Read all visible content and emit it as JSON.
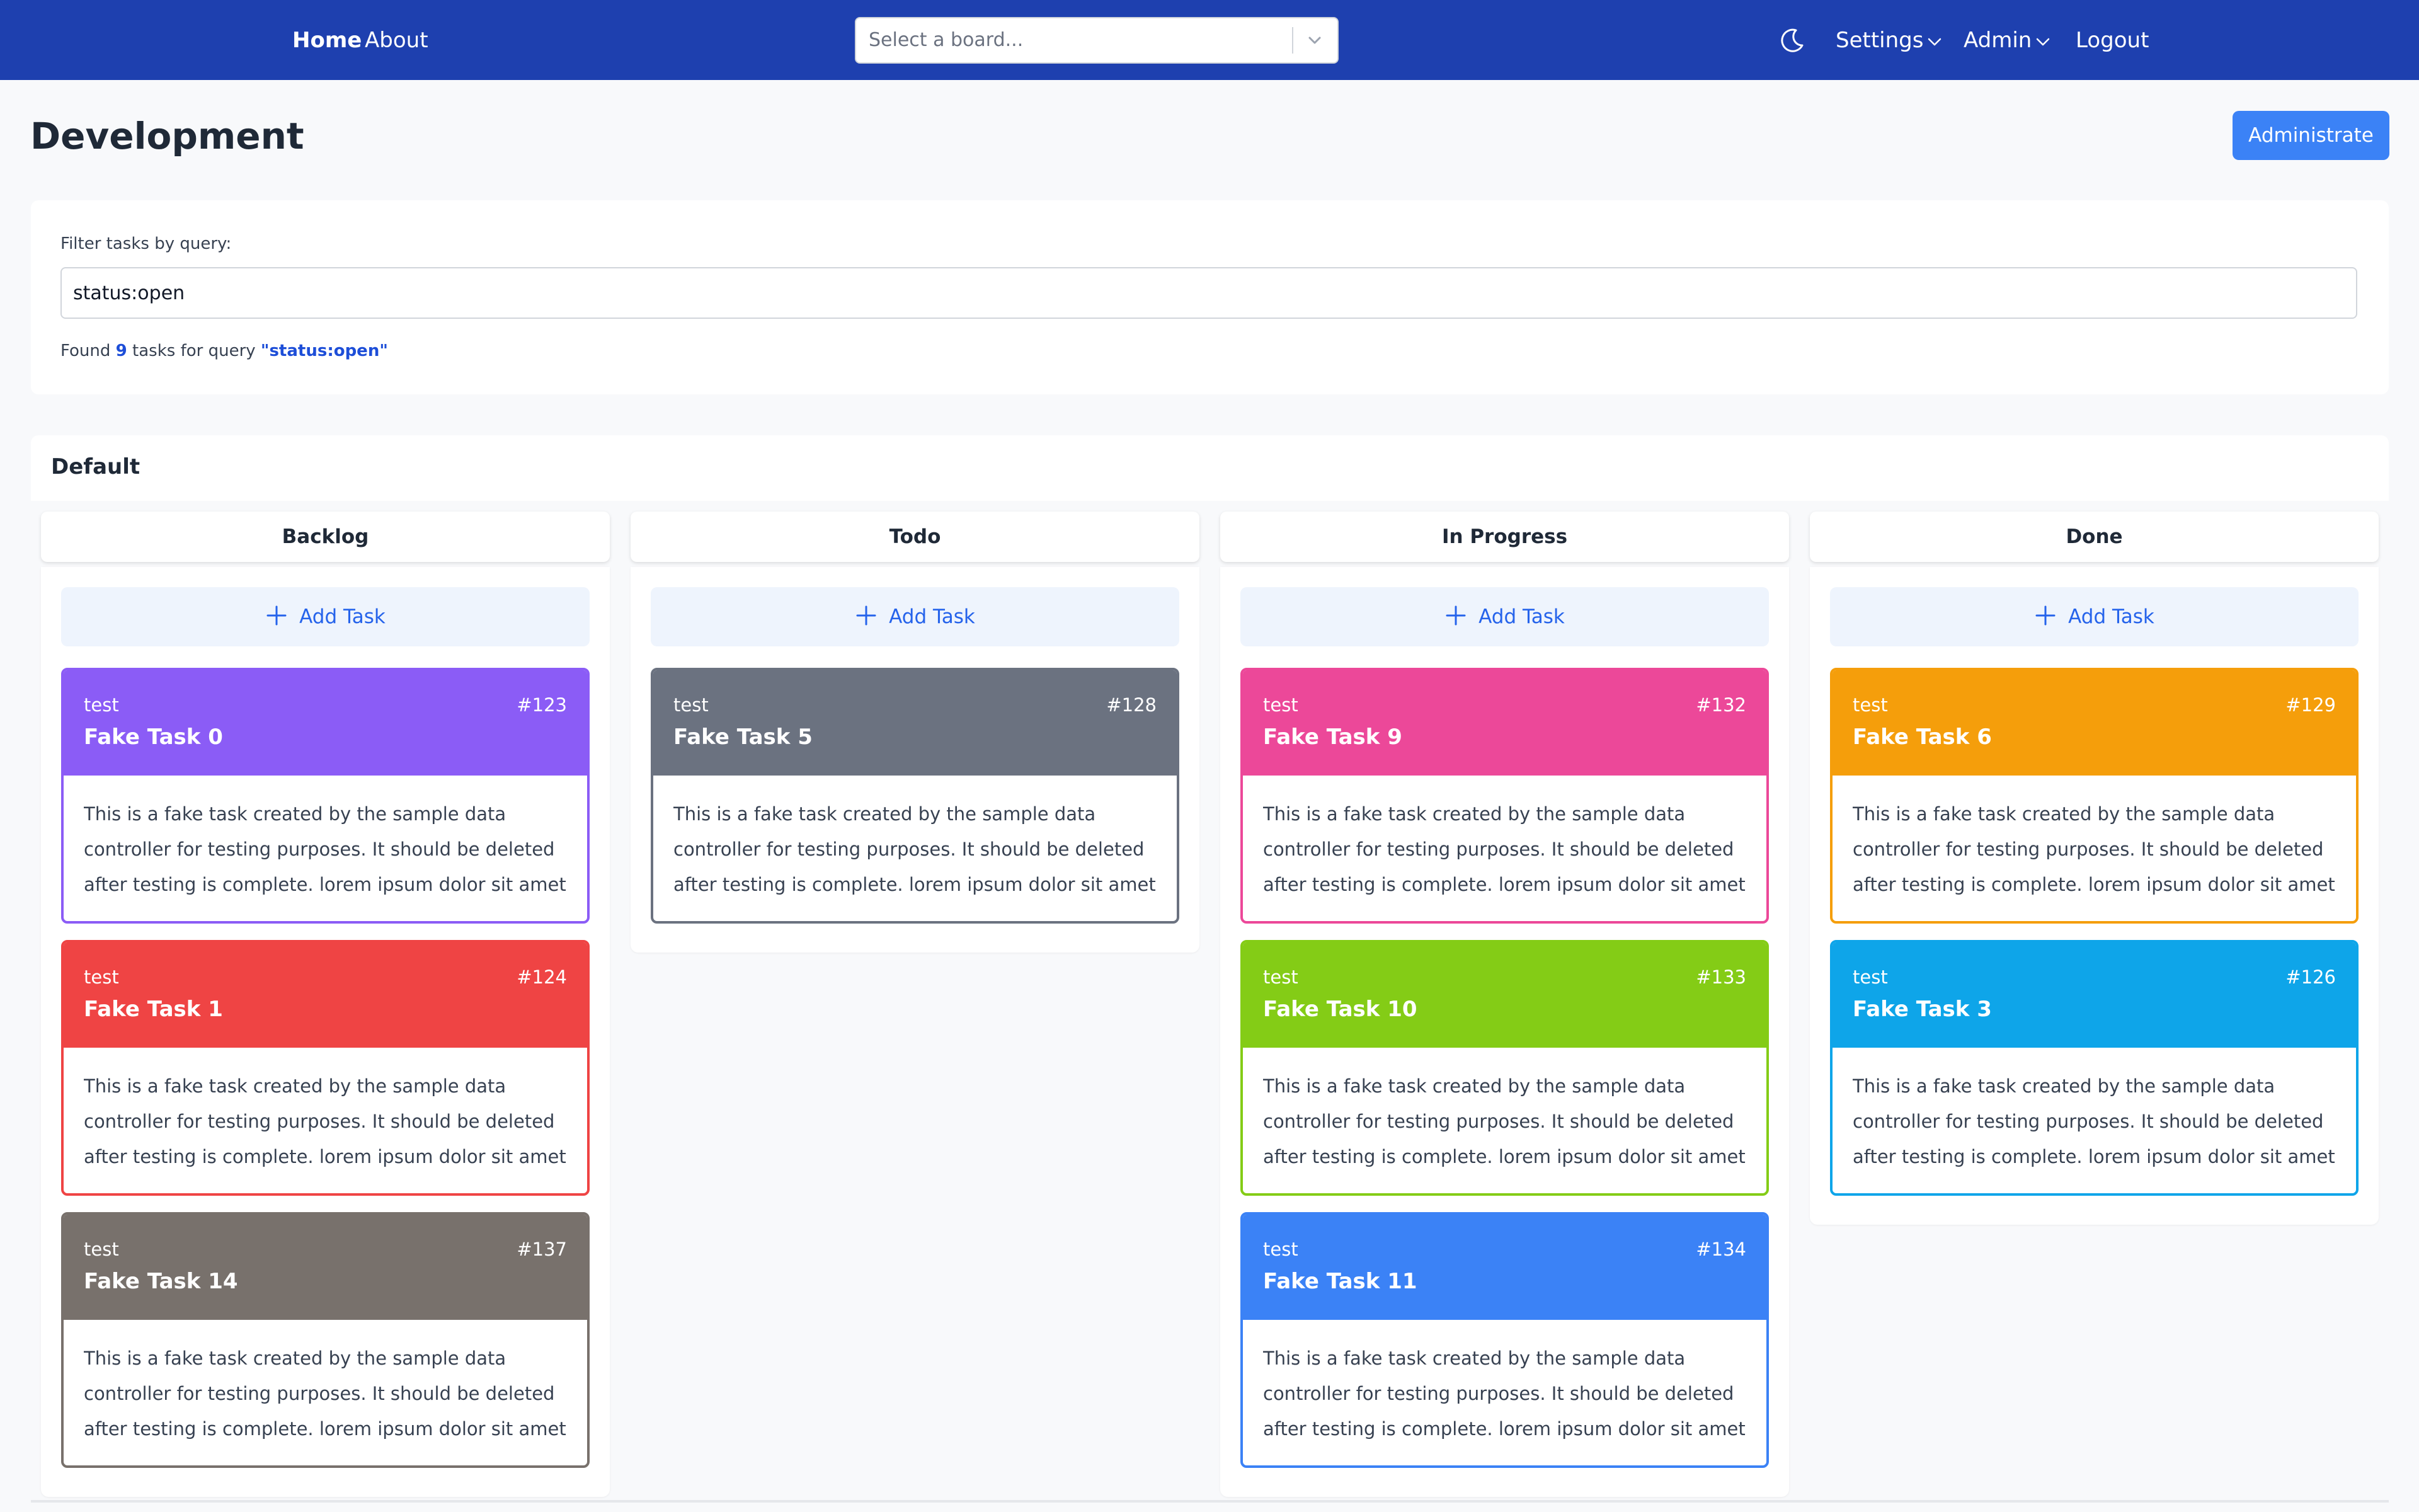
{
  "nav": {
    "home": "Home",
    "about": "About",
    "board_select_placeholder": "Select a board...",
    "settings": "Settings",
    "admin": "Admin",
    "logout": "Logout",
    "theme_icon": "moon-icon"
  },
  "page": {
    "title": "Development",
    "administrate_label": "Administrate"
  },
  "filter": {
    "label": "Filter tasks by query:",
    "value": "status:open",
    "result_prefix": "Found",
    "result_count": "9",
    "result_middle": "tasks for query",
    "result_query": "\"status:open\""
  },
  "board": {
    "name": "Default",
    "add_task_label": "Add Task",
    "columns": [
      {
        "name": "Backlog",
        "tasks": [
          {
            "label": "test",
            "number": "#123",
            "title": "Fake Task 0",
            "color": "#8b5cf6",
            "description": "This is a fake task created by the sample data controller for testing purposes. It should be deleted after testing is complete. lorem ipsum dolor sit amet"
          },
          {
            "label": "test",
            "number": "#124",
            "title": "Fake Task 1",
            "color": "#ef4444",
            "description": "This is a fake task created by the sample data controller for testing purposes. It should be deleted after testing is complete. lorem ipsum dolor sit amet"
          },
          {
            "label": "test",
            "number": "#137",
            "title": "Fake Task 14",
            "color": "#78716c",
            "description": "This is a fake task created by the sample data controller for testing purposes. It should be deleted after testing is complete. lorem ipsum dolor sit amet"
          }
        ]
      },
      {
        "name": "Todo",
        "tasks": [
          {
            "label": "test",
            "number": "#128",
            "title": "Fake Task 5",
            "color": "#6b7280",
            "description": "This is a fake task created by the sample data controller for testing purposes. It should be deleted after testing is complete. lorem ipsum dolor sit amet"
          }
        ]
      },
      {
        "name": "In Progress",
        "tasks": [
          {
            "label": "test",
            "number": "#132",
            "title": "Fake Task 9",
            "color": "#ec4899",
            "description": "This is a fake task created by the sample data controller for testing purposes. It should be deleted after testing is complete. lorem ipsum dolor sit amet"
          },
          {
            "label": "test",
            "number": "#133",
            "title": "Fake Task 10",
            "color": "#84cc16",
            "description": "This is a fake task created by the sample data controller for testing purposes. It should be deleted after testing is complete. lorem ipsum dolor sit amet"
          },
          {
            "label": "test",
            "number": "#134",
            "title": "Fake Task 11",
            "color": "#3b82f6",
            "description": "This is a fake task created by the sample data controller for testing purposes. It should be deleted after testing is complete. lorem ipsum dolor sit amet"
          }
        ]
      },
      {
        "name": "Done",
        "tasks": [
          {
            "label": "test",
            "number": "#129",
            "title": "Fake Task 6",
            "color": "#f59e0b",
            "description": "This is a fake task created by the sample data controller for testing purposes. It should be deleted after testing is complete. lorem ipsum dolor sit amet"
          },
          {
            "label": "test",
            "number": "#126",
            "title": "Fake Task 3",
            "color": "#0ea5e9",
            "description": "This is a fake task created by the sample data controller for testing purposes. It should be deleted after testing is complete. lorem ipsum dolor sit amet"
          }
        ]
      }
    ]
  }
}
